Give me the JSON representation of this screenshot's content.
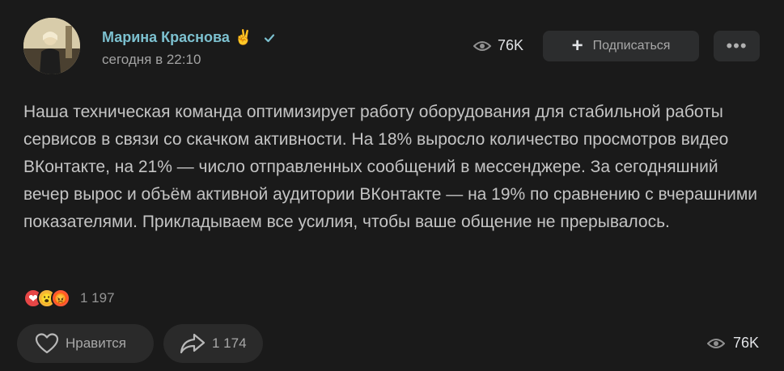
{
  "author": {
    "name": "Марина Краснова",
    "name_emoji": "✌️",
    "time": "сегодня в 22:10"
  },
  "header": {
    "views": "76K",
    "subscribe_label": "Подписаться",
    "more_label": "•••"
  },
  "post": {
    "text": "Наша техническая команда оптимизирует работу оборудования для стабильной работы сервисов в связи со скачком активности. На 18% выросло количество просмотров видео ВКонтакте, на 21% — число отправленных сообщений в мессенджере. За сегодняшний вечер вырос и объём активной аудитории ВКонтакте — на 19% по сравнению с вчерашними показателями. Прикладываем все усилия, чтобы ваше общение не прерывалось."
  },
  "reactions": {
    "emojis": [
      "❤",
      "😮",
      "😡"
    ],
    "count": "1 197"
  },
  "footer": {
    "like_label": "Нравится",
    "share_count": "1 174",
    "views": "76K"
  },
  "colors": {
    "background": "#1a1a1a",
    "author_name": "#7cc0cf",
    "button_bg": "#2c2d2e"
  }
}
